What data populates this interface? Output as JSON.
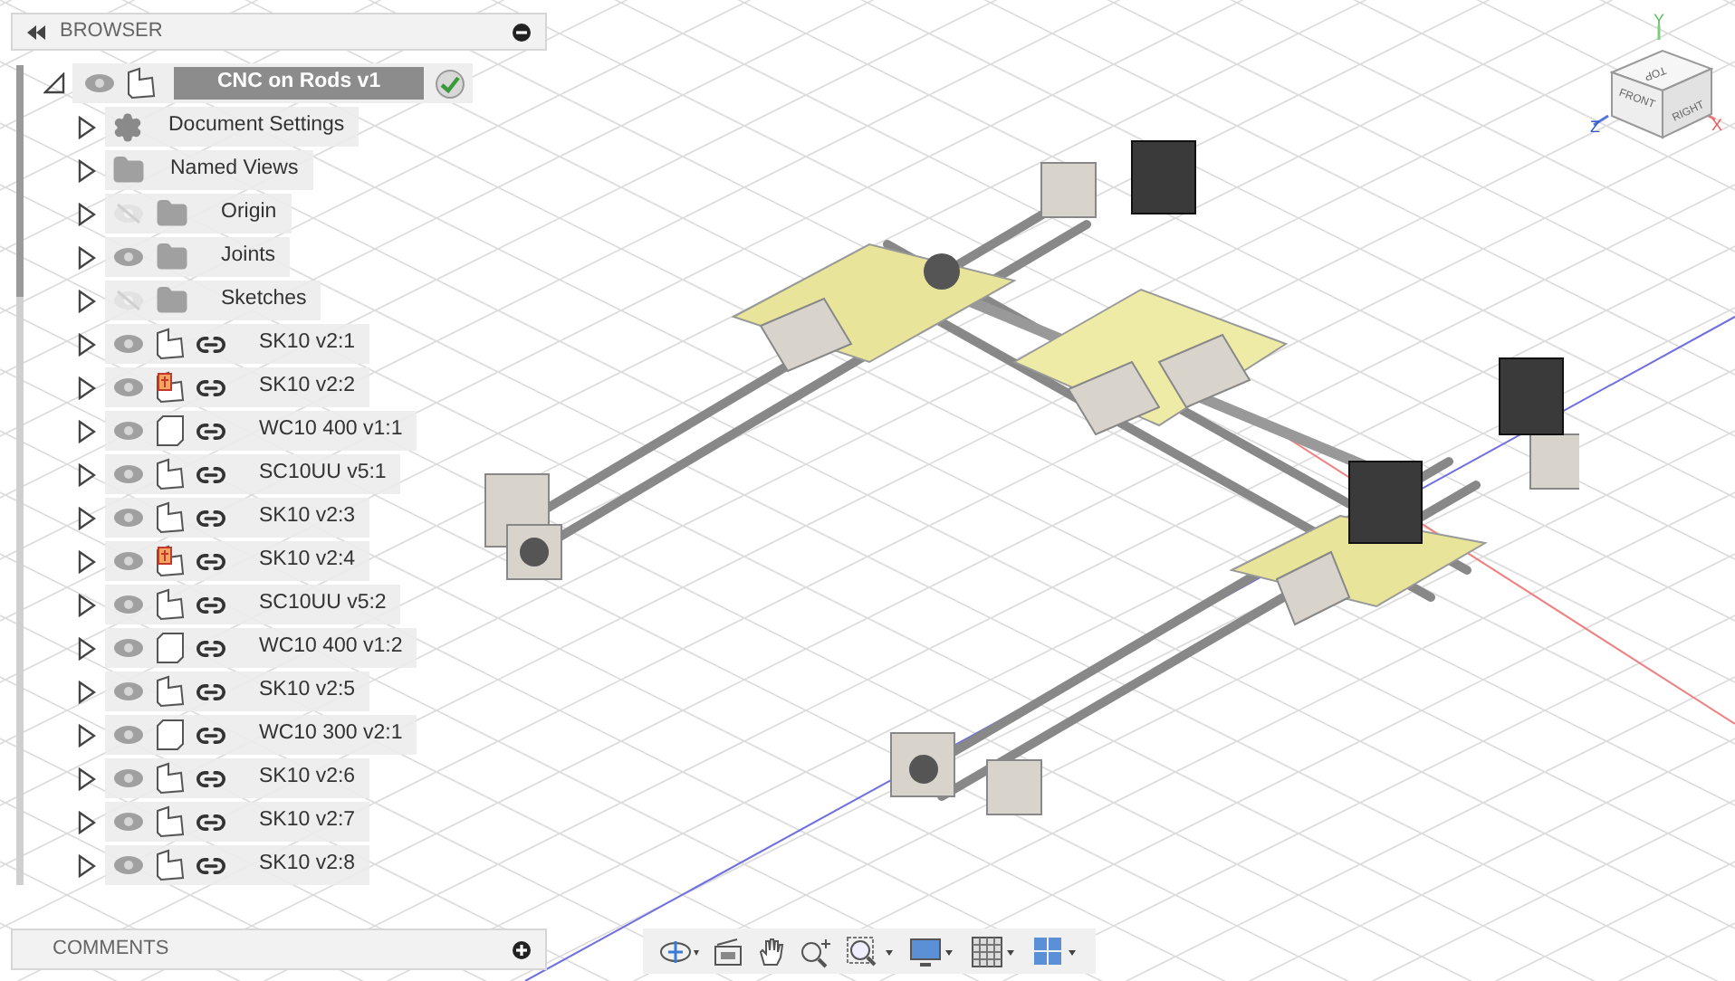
{
  "browser": {
    "title": "BROWSER",
    "root": {
      "label": "CNC on Rods v1",
      "expanded": true,
      "visible": true,
      "active": true,
      "children": [
        {
          "label": "Document Settings",
          "kind": "settings",
          "expanded": false
        },
        {
          "label": "Named Views",
          "kind": "folder",
          "expanded": false
        },
        {
          "label": "Origin",
          "kind": "folder",
          "visible": false,
          "expanded": false
        },
        {
          "label": "Joints",
          "kind": "folder",
          "visible": true,
          "expanded": false
        },
        {
          "label": "Sketches",
          "kind": "folder",
          "visible": false,
          "expanded": false
        },
        {
          "label": "SK10 v2:1",
          "kind": "component",
          "visible": true,
          "linked": true,
          "grounded": false,
          "expanded": false
        },
        {
          "label": "SK10 v2:2",
          "kind": "component",
          "visible": true,
          "linked": true,
          "grounded": true,
          "expanded": false
        },
        {
          "label": "WC10 400 v1:1",
          "kind": "body",
          "visible": true,
          "linked": true,
          "expanded": false
        },
        {
          "label": "SC10UU v5:1",
          "kind": "component",
          "visible": true,
          "linked": true,
          "grounded": false,
          "expanded": false
        },
        {
          "label": "SK10 v2:3",
          "kind": "component",
          "visible": true,
          "linked": true,
          "grounded": false,
          "expanded": false
        },
        {
          "label": "SK10 v2:4",
          "kind": "component",
          "visible": true,
          "linked": true,
          "grounded": true,
          "expanded": false
        },
        {
          "label": "SC10UU v5:2",
          "kind": "component",
          "visible": true,
          "linked": true,
          "grounded": false,
          "expanded": false
        },
        {
          "label": "WC10 400 v1:2",
          "kind": "body",
          "visible": true,
          "linked": true,
          "expanded": false
        },
        {
          "label": "SK10 v2:5",
          "kind": "component",
          "visible": true,
          "linked": true,
          "grounded": false,
          "expanded": false
        },
        {
          "label": "WC10 300 v2:1",
          "kind": "body",
          "visible": true,
          "linked": true,
          "expanded": false
        },
        {
          "label": "SK10 v2:6",
          "kind": "component",
          "visible": true,
          "linked": true,
          "grounded": false,
          "expanded": false
        },
        {
          "label": "SK10 v2:7",
          "kind": "component",
          "visible": true,
          "linked": true,
          "grounded": false,
          "expanded": false
        },
        {
          "label": "SK10 v2:8",
          "kind": "component",
          "visible": true,
          "linked": true,
          "grounded": false,
          "expanded": false
        }
      ]
    }
  },
  "comments": {
    "title": "COMMENTS"
  },
  "view_cube": {
    "top": "TOP",
    "front": "FRONT",
    "right": "RIGHT",
    "x": "X",
    "y": "Y",
    "z": "Z"
  }
}
